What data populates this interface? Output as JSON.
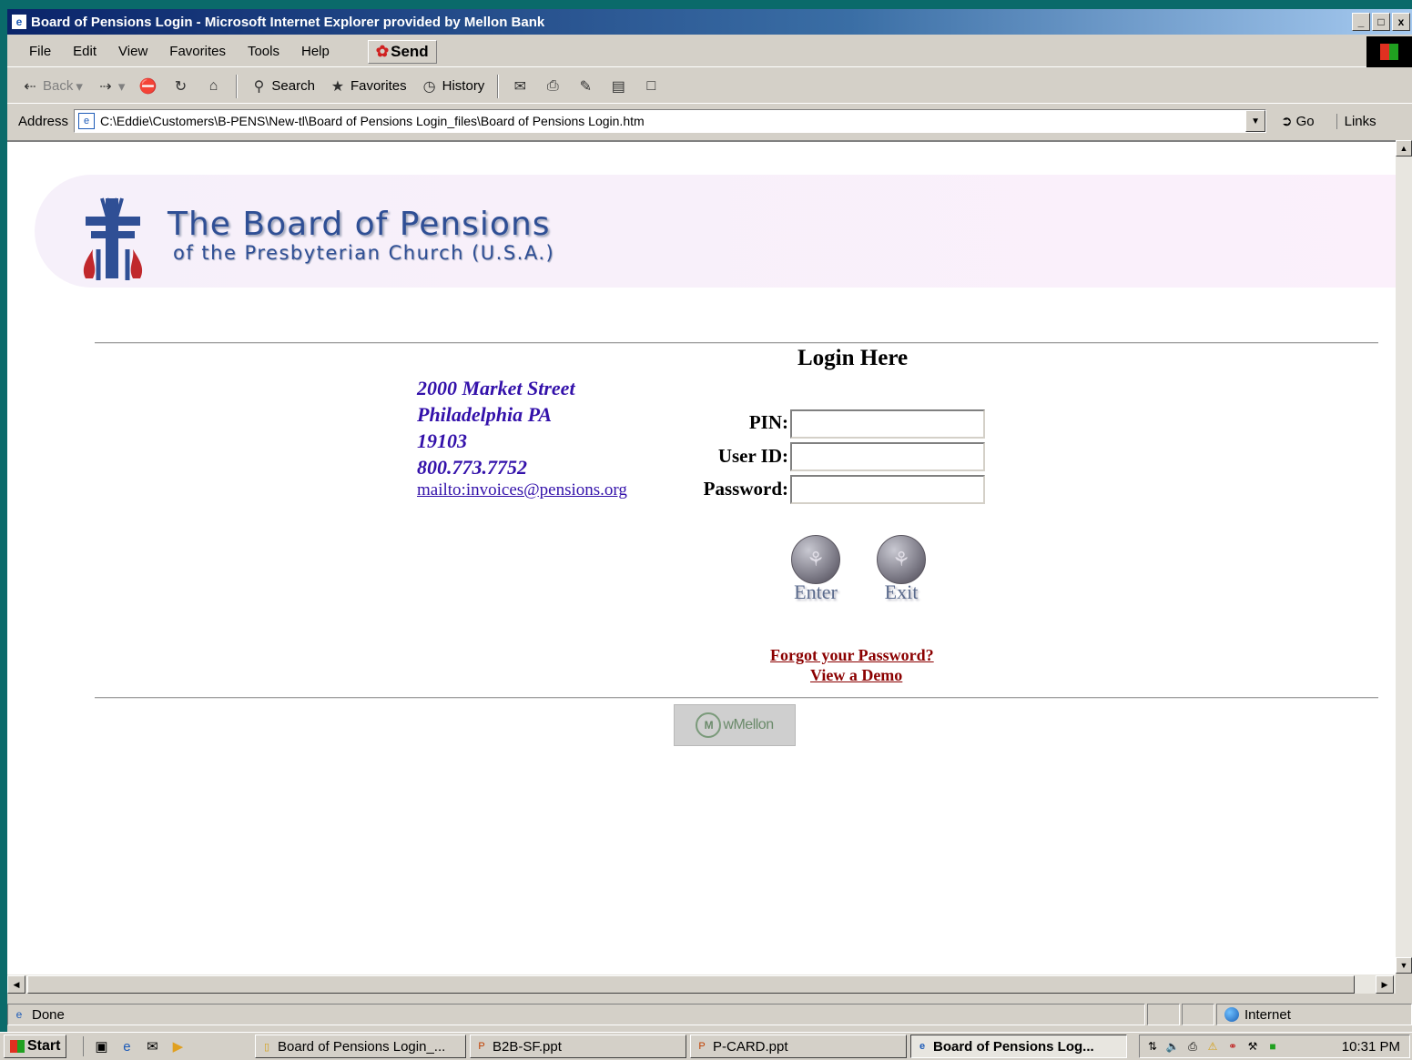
{
  "window": {
    "title": "Board of Pensions Login - Microsoft Internet Explorer provided by Mellon Bank",
    "buttons": [
      "_",
      "□",
      "x"
    ]
  },
  "menu": {
    "items": [
      "File",
      "Edit",
      "View",
      "Favorites",
      "Tools",
      "Help"
    ],
    "send_label": "Send"
  },
  "toolbar": {
    "back_label": "Back",
    "search_label": "Search",
    "favorites_label": "Favorites",
    "history_label": "History"
  },
  "address_bar": {
    "label": "Address",
    "url": "C:\\Eddie\\Customers\\B-PENS\\New-tl\\Board of Pensions Login_files\\Board of Pensions Login.htm",
    "go_label": "Go",
    "links_label": "Links"
  },
  "header": {
    "org_name": "The Board of Pensions",
    "org_subtitle": "of the Presbyterian Church (U.S.A.)"
  },
  "contact": {
    "street": "2000 Market Street",
    "city": "Philadelphia PA",
    "zip": "19103",
    "phone": "800.773.7752",
    "email_link": "mailto:invoices@pensions.org"
  },
  "login": {
    "title": "Login Here",
    "pin_label": "PIN:",
    "pin_value": "",
    "userid_label": "User ID:",
    "userid_value": "",
    "password_label": "Password:",
    "password_value": "",
    "enter_label": "Enter",
    "exit_label": "Exit",
    "forgot_link": "Forgot your Password?",
    "demo_link": "View a Demo"
  },
  "footer": {
    "badge_text": "wMellon"
  },
  "status_bar": {
    "status_text": "Done",
    "zone_text": "Internet"
  },
  "taskbar": {
    "start_label": "Start",
    "tasks": [
      "Board of Pensions Login_...",
      "B2B-SF.ppt",
      "P-CARD.ppt",
      "Board of Pensions Log..."
    ],
    "clock": "10:31 PM"
  },
  "icons": {
    "window_icon": "ie-page-icon",
    "send_icon": "send-icon",
    "start_logo": "windows-logo-icon"
  },
  "colors": {
    "title_gradient_start": "#0a246a",
    "brand_blue": "#2f4f95",
    "address_text": "#3311aa",
    "link_red": "#8b0000",
    "desktop": "#0a6a6a"
  }
}
